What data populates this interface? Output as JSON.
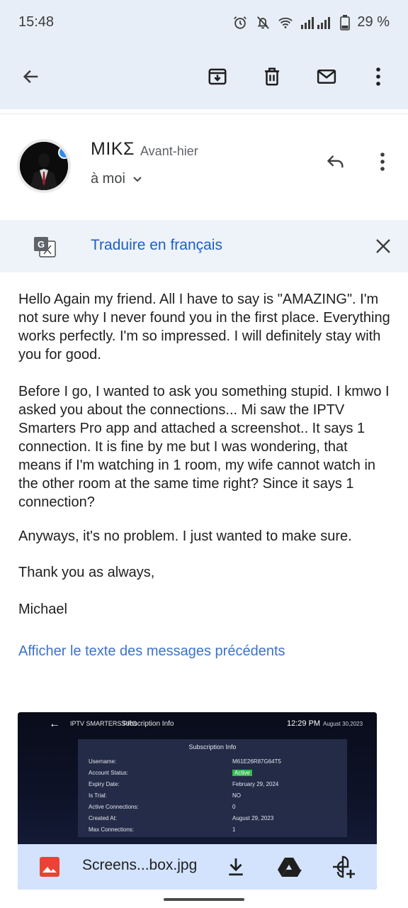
{
  "status_bar": {
    "time": "15:48",
    "battery": "29 %"
  },
  "message": {
    "sender": "ΜΙΚΣ",
    "date": "Avant-hier",
    "recipient": "à moi",
    "translate_label": "Traduire en français",
    "paragraphs": [
      "Hello Again my friend. All I have to say is \"AMAZING\". I'm not sure why I never found you in the first place. Everything works perfectly. I'm so impressed. I will definitely stay with you for good.",
      "Before I go, I wanted to ask you something stupid. I kmwo I asked you about the connections... Mi saw the IPTV Smarters Pro app and attached a screenshot.. It says 1 connection. It is fine by me but I was wondering, that means if I'm watching in 1 room, my wife cannot watch in the other room at the same time right? Since it says 1 connection?",
      "Anyways, it's no problem. I just wanted to make sure.",
      "Thank you as always,",
      "Michael"
    ],
    "show_previous": "Afficher le texte des messages précédents"
  },
  "attachment": {
    "filename": "Screens...box.jpg",
    "preview": {
      "brand": "IPTV SMARTERS PRO",
      "screen_title": "Subscription Info",
      "time": "12:29 PM",
      "date": "August 30,2023",
      "panel_title": "Subscription Info",
      "rows": [
        {
          "label": "Username:",
          "value": "M61E26R87G64T5"
        },
        {
          "label": "Account Status:",
          "value": "Active"
        },
        {
          "label": "Expiry Date:",
          "value": "February 29, 2024"
        },
        {
          "label": "Is Trial:",
          "value": "NO"
        },
        {
          "label": "Active Connections:",
          "value": "0"
        },
        {
          "label": "Created At:",
          "value": "August 29, 2023"
        },
        {
          "label": "Max Connections:",
          "value": "1"
        }
      ]
    }
  },
  "colors": {
    "header_bg": "#e8eef8",
    "link_blue": "#1a60c5",
    "attachment_bar": "#d3e3fd",
    "active_badge": "#2dbd4e"
  },
  "icons": [
    "back-arrow-icon",
    "archive-icon",
    "delete-icon",
    "mark-unread-icon",
    "more-vert-icon",
    "reply-icon",
    "chevron-down-icon",
    "translate-icon",
    "close-icon",
    "image-file-icon",
    "download-icon",
    "drive-icon",
    "add-to-photos-icon",
    "alarm-icon",
    "notifications-off-icon",
    "wifi-icon",
    "signal-icon",
    "battery-icon",
    "verified-badge-icon"
  ]
}
